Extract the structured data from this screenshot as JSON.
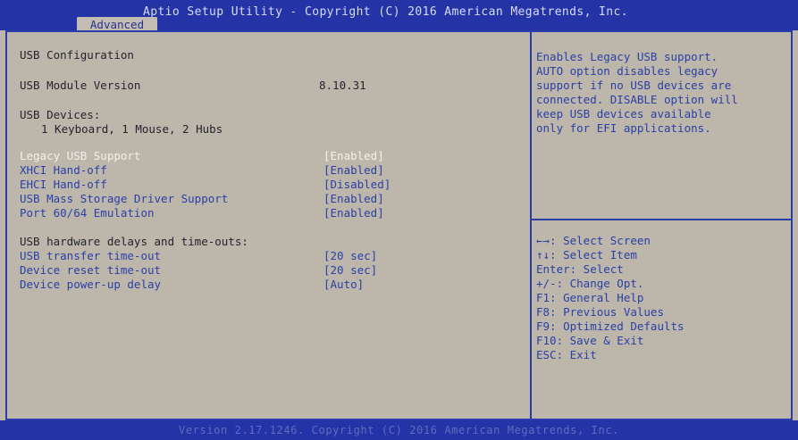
{
  "header": {
    "title": "Aptio Setup Utility - Copyright (C) 2016 American Megatrends, Inc.",
    "tab": "Advanced"
  },
  "main": {
    "section_title": "USB Configuration",
    "module_version_label": "USB Module Version",
    "module_version_value": "8.10.31",
    "devices_label": "USB Devices:",
    "devices_value": "1 Keyboard, 1 Mouse, 2 Hubs",
    "options": [
      {
        "label": "Legacy USB Support",
        "value": "[Enabled]"
      },
      {
        "label": "XHCI Hand-off",
        "value": "[Enabled]"
      },
      {
        "label": "EHCI Hand-off",
        "value": "[Disabled]"
      },
      {
        "label": "USB Mass Storage Driver Support",
        "value": "[Enabled]"
      },
      {
        "label": "Port 60/64 Emulation",
        "value": "[Enabled]"
      }
    ],
    "delays_header": "USB hardware delays and time-outs:",
    "delays": [
      {
        "label": "USB transfer time-out",
        "value": "[20 sec]"
      },
      {
        "label": "Device reset time-out",
        "value": "[20 sec]"
      },
      {
        "label": "Device power-up delay",
        "value": "[Auto]"
      }
    ]
  },
  "help": {
    "lines": [
      "Enables Legacy USB support.",
      "AUTO option disables legacy",
      "support if no USB devices are",
      "connected. DISABLE option will",
      "keep USB devices available",
      "only for EFI applications."
    ]
  },
  "keys": [
    "←→: Select Screen",
    "↑↓: Select Item",
    "Enter: Select",
    "+/-: Change Opt.",
    "F1: General Help",
    "F8: Previous Values",
    "F9: Optimized Defaults",
    "F10: Save & Exit",
    "ESC: Exit"
  ],
  "footer": {
    "version": "Version 2.17.1246. Copyright (C) 2016 American Megatrends, Inc."
  },
  "colors": {
    "header_bg": "#2433a6",
    "panel_bg": "#bdb6ab",
    "option_text": "#2b3fa6",
    "selected_text": "#f4f1ea"
  }
}
